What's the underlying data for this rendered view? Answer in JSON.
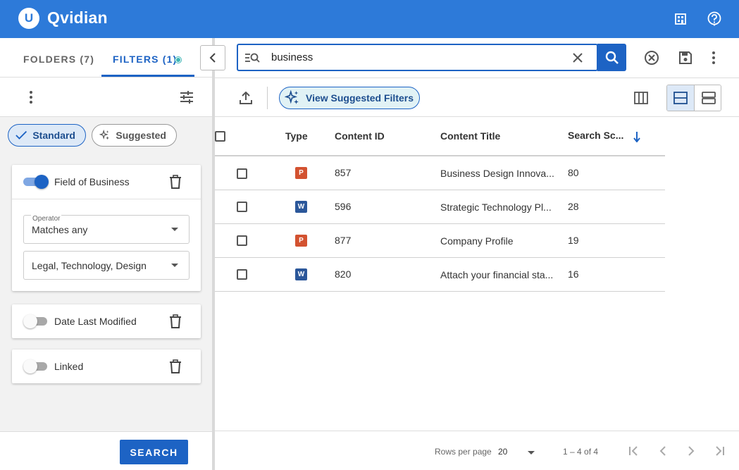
{
  "app": {
    "logo_letter": "U",
    "brand": "Qvidian"
  },
  "left_panel": {
    "tabs": [
      {
        "label": "FOLDERS (7)"
      },
      {
        "label": "FILTERS (1)"
      }
    ],
    "chips": {
      "standard": "Standard",
      "suggested": "Suggested"
    },
    "filters": [
      {
        "label": "Field of Business",
        "enabled": true,
        "operator_label": "Operator",
        "operator_value": "Matches any",
        "values": "Legal, Technology, Design"
      },
      {
        "label": "Date Last Modified",
        "enabled": false
      },
      {
        "label": "Linked",
        "enabled": false
      }
    ],
    "search_button": "SEARCH"
  },
  "search": {
    "query": "business"
  },
  "toolbar": {
    "suggested_filters_label": "View Suggested Filters"
  },
  "table": {
    "headers": {
      "type": "Type",
      "content_id": "Content ID",
      "content_title": "Content Title",
      "search_score": "Search Sc..."
    },
    "rows": [
      {
        "type": "P",
        "content_id": "857",
        "title": "Business Design Innova...",
        "score": "80"
      },
      {
        "type": "W",
        "content_id": "596",
        "title": "Strategic Technology Pl...",
        "score": "28"
      },
      {
        "type": "P",
        "content_id": "877",
        "title": "Company Profile",
        "score": "19"
      },
      {
        "type": "W",
        "content_id": "820",
        "title": "Attach your financial sta...",
        "score": "16"
      }
    ]
  },
  "footer": {
    "rows_per_page_label": "Rows per page",
    "rows_per_page_value": "20",
    "range": "1 – 4 of 4"
  },
  "colors": {
    "brand_blue": "#2d7ad9",
    "accent_blue": "#1d63c4",
    "ppt_red": "#d35230",
    "word_blue": "#2b579a",
    "teal_dot": "#3fb6b6"
  }
}
